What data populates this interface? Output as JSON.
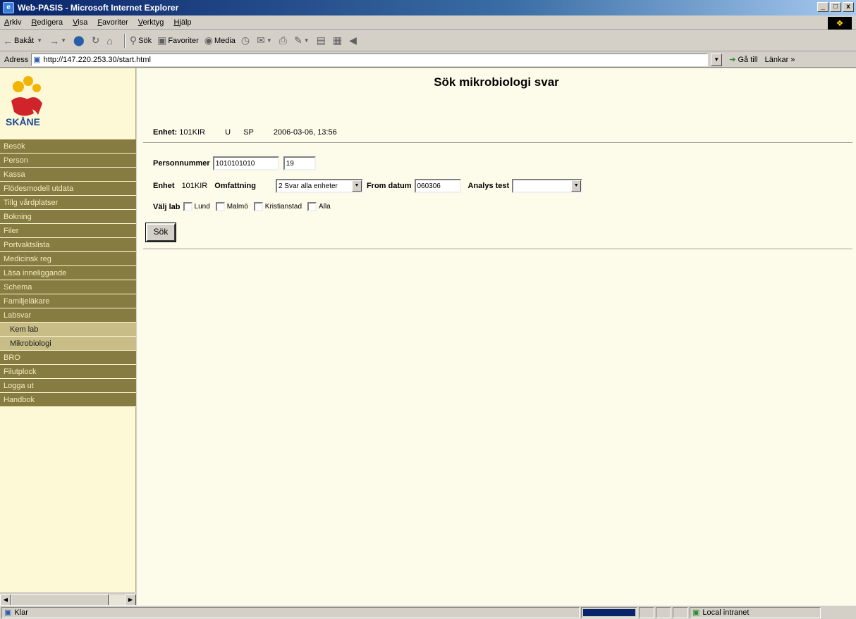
{
  "window": {
    "title": "Web-PASIS - Microsoft Internet Explorer",
    "min": "_",
    "max": "□",
    "close": "x"
  },
  "menu": {
    "items": [
      "Arkiv",
      "Redigera",
      "Visa",
      "Favoriter",
      "Verktyg",
      "Hjälp"
    ]
  },
  "toolbar": {
    "back": "Bakåt",
    "search": "Sök",
    "favorites": "Favoriter",
    "media": "Media"
  },
  "address": {
    "label": "Adress",
    "url": "http://147.220.253.30/start.html",
    "go": "Gå till",
    "links": "Länkar »"
  },
  "sidebar": {
    "logo_text": "SKÅNE",
    "items": [
      {
        "label": "Besök"
      },
      {
        "label": "Person"
      },
      {
        "label": "Kassa"
      },
      {
        "label": "Flödesmodell utdata"
      },
      {
        "label": "Tillg vårdplatser"
      },
      {
        "label": "Bokning"
      },
      {
        "label": "Filer"
      },
      {
        "label": "Portvaktslista"
      },
      {
        "label": "Medicinsk reg"
      },
      {
        "label": "Läsa inneliggande"
      },
      {
        "label": "Schema"
      },
      {
        "label": "Familjeläkare"
      },
      {
        "label": "Labsvar"
      }
    ],
    "sub_items": [
      {
        "label": "Kem lab"
      },
      {
        "label": "Mikrobiologi"
      }
    ],
    "items_after": [
      {
        "label": "BRO"
      },
      {
        "label": "Filutplock"
      },
      {
        "label": "Logga ut"
      },
      {
        "label": "Handbok"
      }
    ]
  },
  "main": {
    "title": "Sök mikrobiologi svar",
    "info": {
      "enhet_label": "Enhet:",
      "enhet_value": "101KIR",
      "u": "U",
      "sp": "SP",
      "datetime": "2006-03-06, 13:56"
    },
    "form": {
      "personnummer_label": "Personnummer",
      "personnummer_value": "1010101010",
      "century_value": "19",
      "enhet_label": "Enhet",
      "enhet_value": "101KIR",
      "omfattning_label": "Omfattning",
      "omfattning_value": "2 Svar alla enheter",
      "from_datum_label": "From datum",
      "from_datum_value": "060306",
      "analys_label": "Analys test",
      "analys_value": "",
      "valj_lab_label": "Välj lab",
      "labs": [
        "Lund",
        "Malmö",
        "Kristianstad",
        "Alla"
      ],
      "submit": "Sök"
    }
  },
  "status": {
    "text": "Klar",
    "progress": 1.0,
    "zone": "Local intranet"
  }
}
